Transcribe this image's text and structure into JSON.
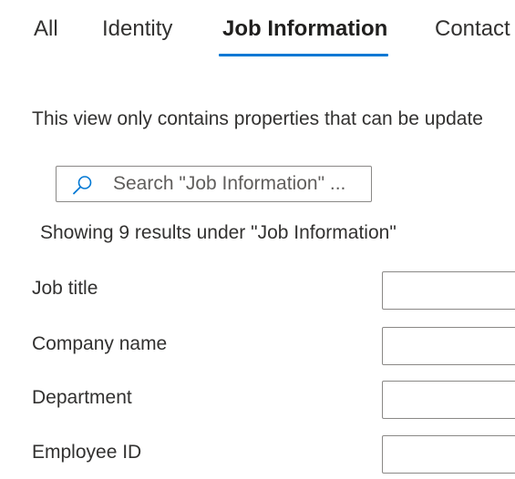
{
  "tabs": [
    {
      "label": "All",
      "active": false
    },
    {
      "label": "Identity",
      "active": false
    },
    {
      "label": "Job Information",
      "active": true
    },
    {
      "label": "Contact",
      "active": false
    }
  ],
  "accent_color": "#0078d4",
  "info_text": "This view only contains properties that can be update",
  "search": {
    "icon": "search-icon",
    "value": "",
    "placeholder": "Search \"Job Information\" ..."
  },
  "results_text": "Showing 9 results under \"Job Information\"",
  "fields": [
    {
      "label": "Job title",
      "value": ""
    },
    {
      "label": "Company name",
      "value": ""
    },
    {
      "label": "Department",
      "value": ""
    },
    {
      "label": "Employee ID",
      "value": ""
    }
  ]
}
